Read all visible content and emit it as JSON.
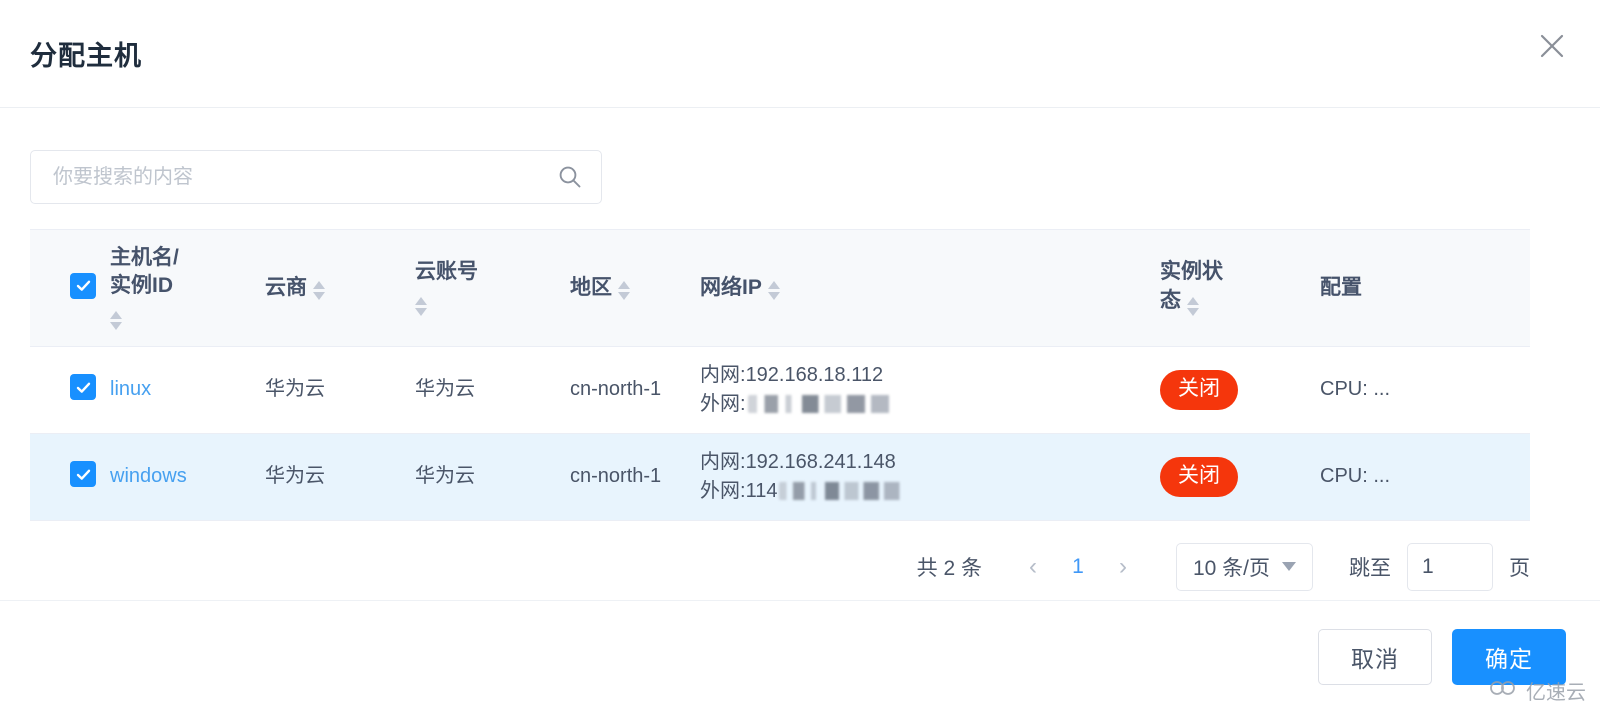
{
  "dialog": {
    "title": "分配主机",
    "close_icon": "close-icon"
  },
  "search": {
    "placeholder": "你要搜索的内容",
    "value": "",
    "icon": "search-icon"
  },
  "table": {
    "select_all_checked": true,
    "columns": [
      {
        "key": "select",
        "label": "",
        "sortable": false
      },
      {
        "key": "name",
        "label": "主机名/实例ID",
        "label_line1": "主机名/",
        "label_line2": "实例ID",
        "sortable": true
      },
      {
        "key": "vendor",
        "label": "云商",
        "sortable": true
      },
      {
        "key": "account",
        "label": "云账号",
        "sortable": true
      },
      {
        "key": "region",
        "label": "地区",
        "sortable": true
      },
      {
        "key": "ip",
        "label": "网络IP",
        "sortable": true
      },
      {
        "key": "status",
        "label": "实例状态",
        "label_line1": "实例状",
        "label_line2": "态",
        "sortable": true
      },
      {
        "key": "spec",
        "label": "配置",
        "sortable": false
      }
    ],
    "rows": [
      {
        "checked": true,
        "name": "linux",
        "vendor": "华为云",
        "account": "华为云",
        "region": "cn-north-1",
        "ip_internal_label": "内网:",
        "ip_internal": "192.168.18.112",
        "ip_external_label": "外网:",
        "ip_external": "",
        "ip_external_masked": true,
        "status": "关闭",
        "status_color": "#f5360c",
        "spec": "CPU: ...",
        "highlighted": false
      },
      {
        "checked": true,
        "name": "windows",
        "vendor": "华为云",
        "account": "华为云",
        "region": "cn-north-1",
        "ip_internal_label": "内网:",
        "ip_internal": "192.168.241.148",
        "ip_external_label": "外网:",
        "ip_external": "114",
        "ip_external_masked": true,
        "status": "关闭",
        "status_color": "#f5360c",
        "spec": "CPU: ...",
        "highlighted": true
      }
    ]
  },
  "pagination": {
    "total_text": "共 2 条",
    "prev_icon": "chevron-left-icon",
    "next_icon": "chevron-right-icon",
    "current_page": "1",
    "page_size_label": "10 条/页",
    "page_size_chevron": "chevron-down-icon",
    "jump_label": "跳至",
    "jump_value": "1",
    "jump_unit": "页"
  },
  "footer": {
    "cancel_label": "取消",
    "confirm_label": "确定",
    "confirm_color": "#1890ff"
  },
  "watermark": {
    "text": "亿速云",
    "icon": "cloud-icon"
  },
  "theme": {
    "accent": "#1890ff",
    "link": "#46a0f0",
    "danger": "#f5360c",
    "row_highlight": "#e8f4fd",
    "header_bg": "#f7f9fb"
  }
}
